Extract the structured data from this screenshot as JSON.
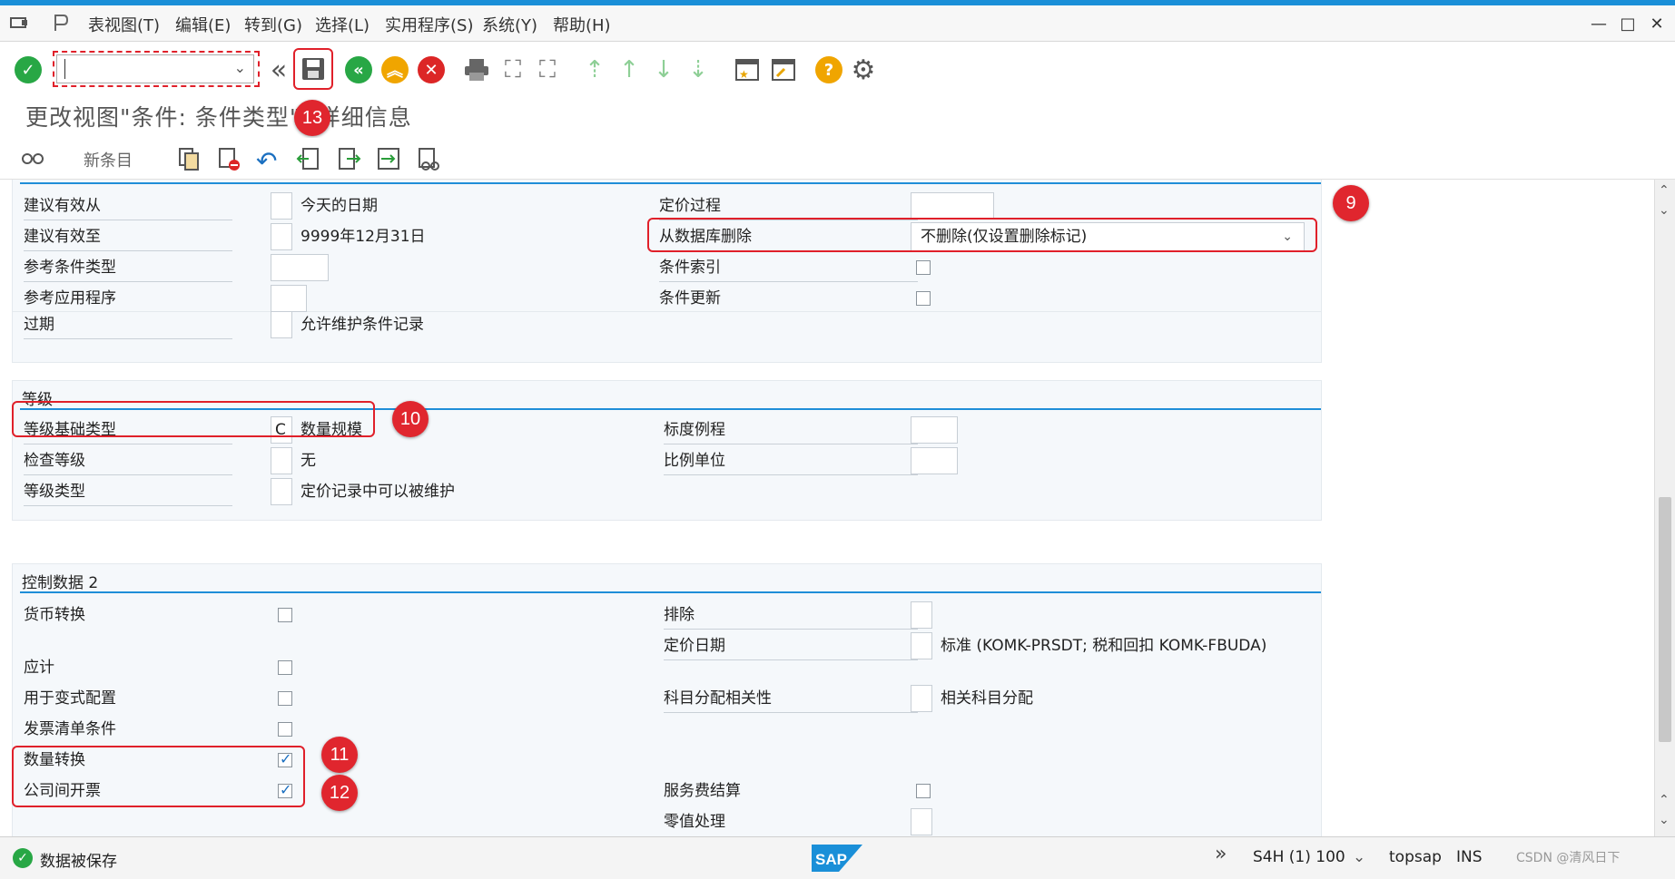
{
  "menu": {
    "items": [
      "表视图(T)",
      "编辑(E)",
      "转到(G)",
      "选择(L)",
      "实用程序(S)",
      "系统(Y)",
      "帮助(H)"
    ]
  },
  "window_controls": {
    "minimize": "—",
    "maximize": "□",
    "close": "✕"
  },
  "toolbar": {
    "command_field_value": ""
  },
  "title": "更改视图\"条件: 条件类型\": 详细信息",
  "app_toolbar": {
    "new_entries_label": "新条目"
  },
  "markers": [
    "9",
    "10",
    "11",
    "12",
    "13"
  ],
  "section_top": {
    "left_rows": [
      {
        "label": "建议有效从",
        "value": "",
        "text": "今天的日期"
      },
      {
        "label": "建议有效至",
        "value": "",
        "text": "9999年12月31日"
      },
      {
        "label": "参考条件类型",
        "value": "",
        "text": ""
      },
      {
        "label": "参考应用程序",
        "value": "",
        "text": ""
      },
      {
        "label": "过期",
        "value": "",
        "text": "允许维护条件记录"
      }
    ],
    "right_rows": [
      {
        "label": "定价过程",
        "value": ""
      },
      {
        "label": "从数据库删除",
        "value": "不删除(仅设置删除标记)"
      },
      {
        "label": "条件索引",
        "checked": false
      },
      {
        "label": "条件更新",
        "checked": false
      }
    ]
  },
  "section_scales": {
    "title": "等级",
    "left_rows": [
      {
        "label": "等级基础类型",
        "value": "C",
        "text": "数量规模"
      },
      {
        "label": "检查等级",
        "value": "",
        "text": "无"
      },
      {
        "label": "等级类型",
        "value": "",
        "text": "定价记录中可以被维护"
      }
    ],
    "right_rows": [
      {
        "label": "标度例程",
        "value": ""
      },
      {
        "label": "比例单位",
        "value": ""
      }
    ]
  },
  "section_control2": {
    "title": "控制数据 2",
    "left_rows": [
      {
        "label": "货币转换",
        "checked": false
      },
      {
        "label": "应计",
        "checked": false
      },
      {
        "label": "用于变式配置",
        "checked": false
      },
      {
        "label": "发票清单条件",
        "checked": false
      },
      {
        "label": "数量转换",
        "checked": true
      },
      {
        "label": "公司间开票",
        "checked": true
      }
    ],
    "right_rows": [
      {
        "label": "排除",
        "value": "",
        "text": ""
      },
      {
        "label": "定价日期",
        "value": "",
        "text": "标准 (KOMK-PRSDT; 税和回扣 KOMK-FBUDA)"
      },
      {
        "label": "科目分配相关性",
        "value": "",
        "text": "相关科目分配"
      },
      {
        "label": "服务费结算",
        "checked": false
      },
      {
        "label": "零值处理",
        "value": ""
      }
    ]
  },
  "status": {
    "message": "数据被保存",
    "system": "S4H (1) 100",
    "user": "topsap",
    "mode": "INS",
    "watermark": "CSDN @清风日下"
  },
  "colors": {
    "accent": "#1f8ed8",
    "annotation": "#e0262e"
  }
}
